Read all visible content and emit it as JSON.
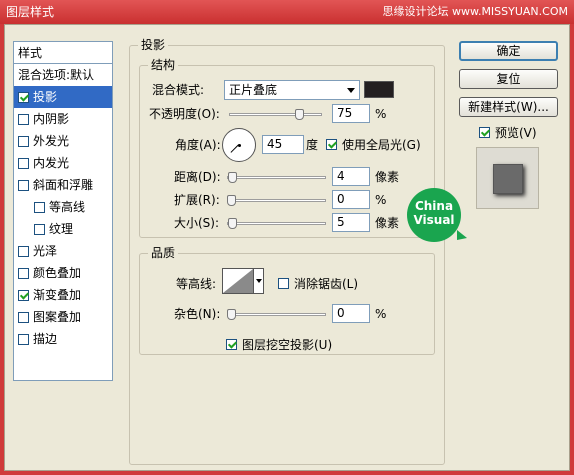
{
  "window": {
    "title": "图层样式",
    "watermark": "思缘设计论坛 www.MISSYUAN.COM"
  },
  "stylelist": {
    "header": "样式",
    "blend": "混合选项:默认",
    "items": [
      {
        "label": "投影",
        "checked": true,
        "selected": true
      },
      {
        "label": "内阴影",
        "checked": false
      },
      {
        "label": "外发光",
        "checked": false
      },
      {
        "label": "内发光",
        "checked": false
      },
      {
        "label": "斜面和浮雕",
        "checked": false
      },
      {
        "label": "等高线",
        "checked": false
      },
      {
        "label": "纹理",
        "checked": false
      },
      {
        "label": "光泽",
        "checked": false
      },
      {
        "label": "颜色叠加",
        "checked": false
      },
      {
        "label": "渐变叠加",
        "checked": true
      },
      {
        "label": "图案叠加",
        "checked": false
      },
      {
        "label": "描边",
        "checked": false
      }
    ]
  },
  "shadow": {
    "group_title": "投影",
    "structure_title": "结构",
    "blend_mode_label": "混合模式:",
    "blend_mode_value": "正片叠底",
    "shadow_color": "#231f20",
    "opacity_label": "不透明度(O):",
    "opacity_value": "75",
    "percent": "%",
    "angle_label": "角度(A):",
    "angle_value": "45",
    "degree_unit": "度",
    "global_light_label": "使用全局光(G)",
    "distance_label": "距离(D):",
    "distance_value": "4",
    "spread_label": "扩展(R):",
    "spread_value": "0",
    "size_label": "大小(S):",
    "size_value": "5",
    "pixel_unit": "像素"
  },
  "quality": {
    "title": "品质",
    "contour_label": "等高线:",
    "antialias_label": "消除锯齿(L)",
    "noise_label": "杂色(N):",
    "noise_value": "0",
    "percent": "%",
    "knockout_label": "图层挖空投影(U)"
  },
  "buttons": {
    "ok": "确定",
    "reset": "复位",
    "new_style": "新建样式(W)...",
    "preview_label": "预览(V)"
  },
  "logo": {
    "line1": "China",
    "line2": "Visual",
    "color": "#1aa54f"
  }
}
